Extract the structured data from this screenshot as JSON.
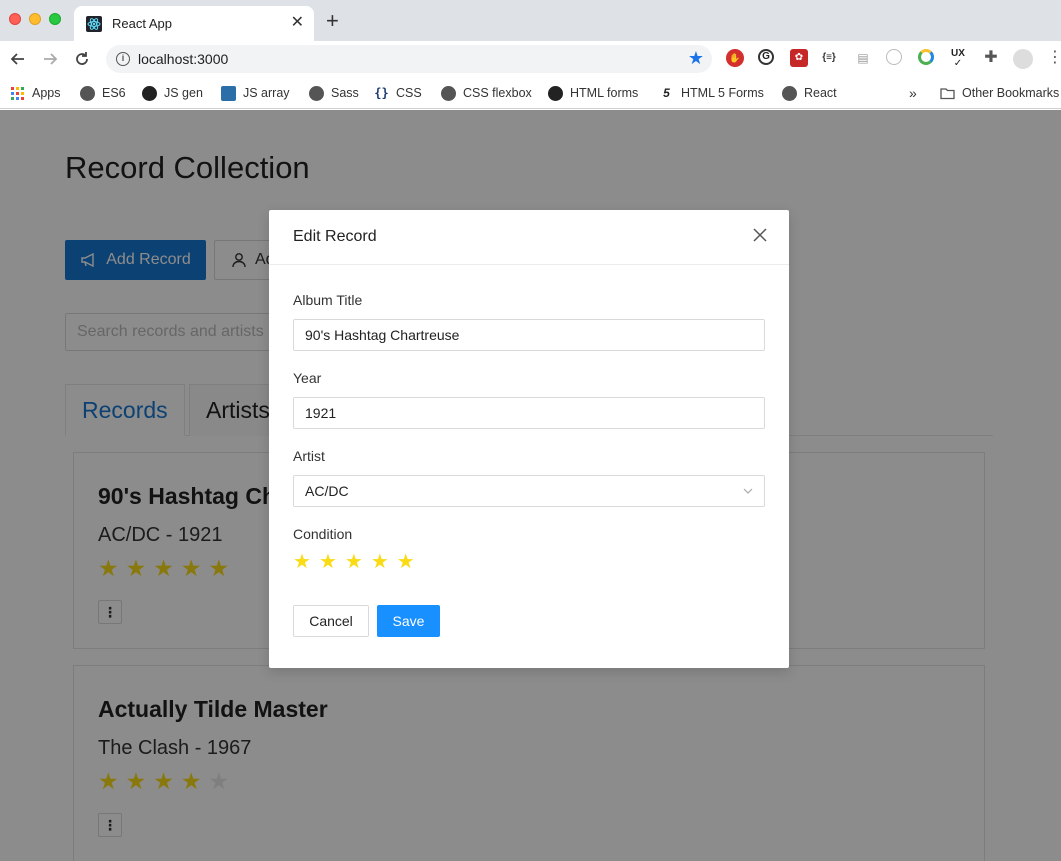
{
  "browser": {
    "tab_title": "React App",
    "url": "localhost:3000",
    "bookmarks": [
      {
        "label": "Apps",
        "icon": "apps-grid-icon"
      },
      {
        "label": "ES6",
        "icon": "globe-icon"
      },
      {
        "label": "JS gen",
        "icon": "github-icon"
      },
      {
        "label": "JS array",
        "icon": "bookmark-image-icon"
      },
      {
        "label": "Sass",
        "icon": "globe-icon"
      },
      {
        "label": "CSS",
        "icon": "braces-icon"
      },
      {
        "label": "CSS flexbox",
        "icon": "globe-icon"
      },
      {
        "label": "HTML forms",
        "icon": "github-icon"
      },
      {
        "label": "HTML 5 Forms",
        "icon": "five-icon"
      },
      {
        "label": "React",
        "icon": "globe-icon"
      }
    ],
    "other_bookmarks": "Other Bookmarks",
    "overflow": "»"
  },
  "page": {
    "title": "Record Collection",
    "add_record_label": "Add Record",
    "add_artist_label": "Add Artist",
    "search_placeholder": "Search records and artists",
    "tabs": [
      {
        "label": "Records",
        "active": true
      },
      {
        "label": "Artists",
        "active": false
      }
    ],
    "records": [
      {
        "title": "90's Hashtag Chartreuse",
        "subtitle": "AC/DC - 1921",
        "rating": 5
      },
      {
        "title": "Actually Tilde Master",
        "subtitle": "The Clash - 1967",
        "rating": 4
      }
    ],
    "menu_glyph": "⋮"
  },
  "modal": {
    "title": "Edit Record",
    "album_title_label": "Album Title",
    "album_title_value": "90's Hashtag Chartreuse",
    "year_label": "Year",
    "year_value": "1921",
    "artist_label": "Artist",
    "artist_value": "AC/DC",
    "condition_label": "Condition",
    "condition_rating": 5,
    "cancel_label": "Cancel",
    "save_label": "Save"
  },
  "colors": {
    "primary": "#1677d2",
    "save": "#1890ff",
    "star": "#fadb14"
  }
}
